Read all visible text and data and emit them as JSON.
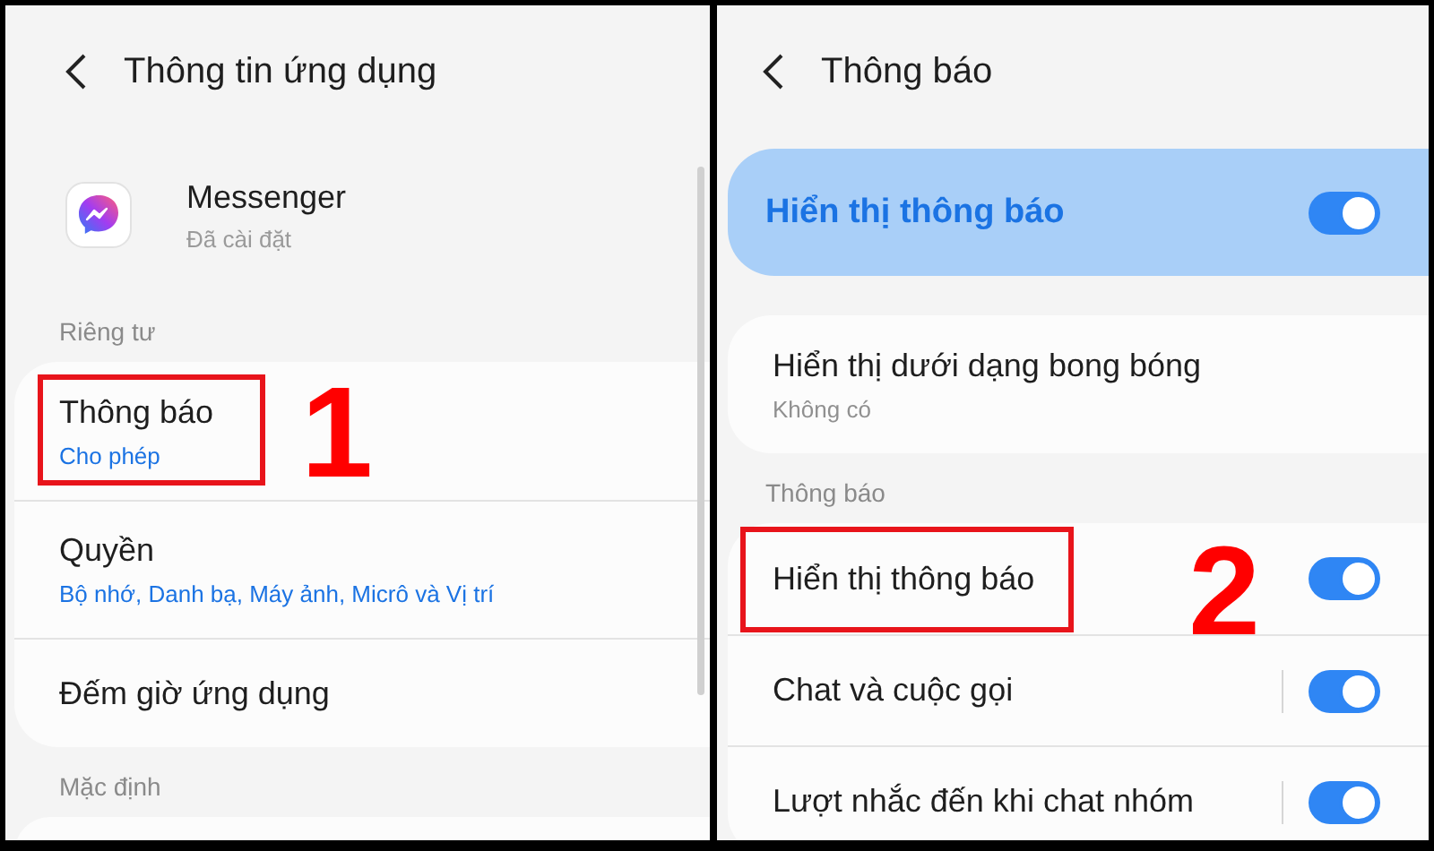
{
  "panels": [
    {
      "title": "Thông tin ứng dụng",
      "app": {
        "name": "Messenger",
        "status": "Đã cài đặt"
      },
      "scrollbar": true,
      "sections": [
        {
          "header": "Riêng tư",
          "items": [
            {
              "kind": "link",
              "title": "Thông báo",
              "subtitle": "Cho phép",
              "subtitle_accent": true,
              "highlighted": true,
              "callout": "1"
            },
            {
              "kind": "link",
              "title": "Quyền",
              "subtitle": "Bộ nhớ, Danh bạ, Máy ảnh, Micrô và Vị trí",
              "subtitle_accent": true,
              "highlighted": false
            },
            {
              "kind": "link",
              "title": "Đếm giờ ứng dụng",
              "highlighted": false
            }
          ]
        },
        {
          "header": "Mặc định"
        }
      ]
    },
    {
      "title": "Thông báo",
      "banner": {
        "label": "Hiển thị thông báo",
        "on": true
      },
      "sections": [
        {
          "items": [
            {
              "kind": "link",
              "title": "Hiển thị dưới dạng bong bóng",
              "subtitle": "Không có",
              "subtitle_accent": false,
              "highlighted": false
            }
          ]
        },
        {
          "header": "Thông báo",
          "items": [
            {
              "kind": "toggle",
              "title": "Hiển thị thông báo",
              "on": true,
              "split": false,
              "highlighted": true,
              "callout": "2"
            },
            {
              "kind": "toggle",
              "title": "Chat và cuộc gọi",
              "on": true,
              "split": true,
              "highlighted": false
            },
            {
              "kind": "toggle",
              "title": "Lượt nhắc đến khi chat nhóm",
              "on": true,
              "split": true,
              "highlighted": false
            }
          ]
        }
      ]
    }
  ]
}
